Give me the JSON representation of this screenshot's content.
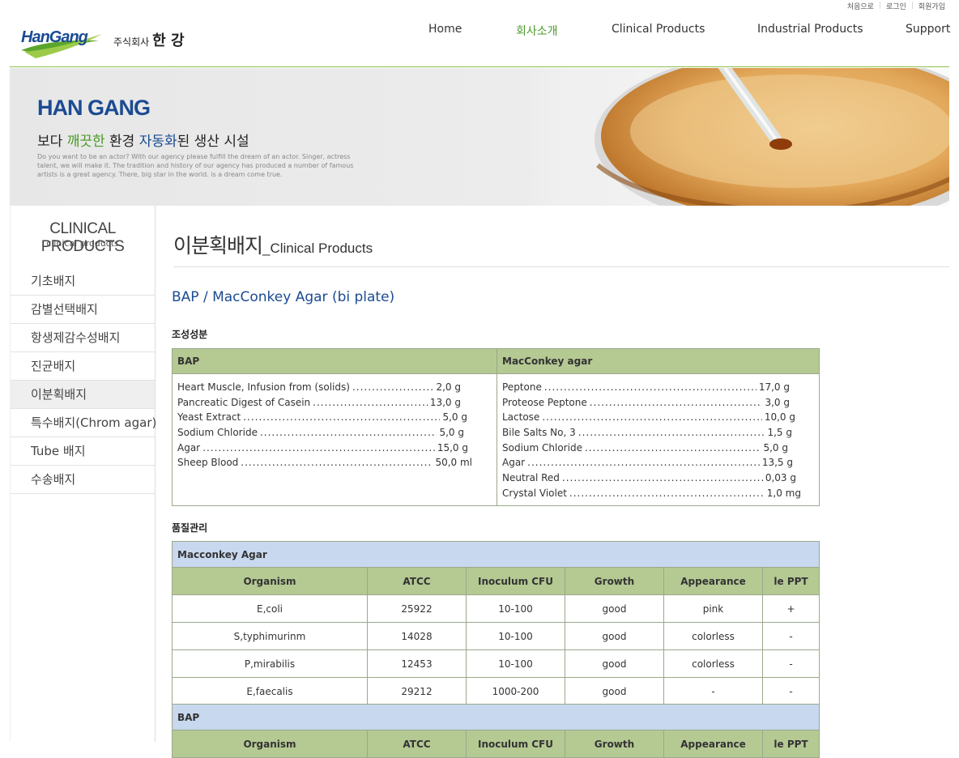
{
  "util": {
    "home": "처음으로",
    "login": "로그인",
    "join": "회원가입"
  },
  "logo": {
    "text": "HanGang",
    "company_prefix": "주식회사",
    "company_name": "한 강"
  },
  "nav": [
    "Home",
    "회사소개",
    "Clinical Products",
    "Industrial Products",
    "Support"
  ],
  "banner": {
    "title": "HAN GANG",
    "slogan_1": "보다 ",
    "slogan_green": "깨끗한",
    "slogan_2": " 환경 ",
    "slogan_blue": "자동화",
    "slogan_3": "된 생산 시설",
    "desc": "Do you want to be an actor? With our agency please fulfill the dream of an actor. Singer, actress talent, we will make it. The tradition and history of our agency has produced a number of famous artists is a great agency. There, big star in the world. is a dream come true."
  },
  "sidebar": {
    "title": "CLINICAL PRODUCTS",
    "subtitle": "clinical products",
    "items": [
      "기초배지",
      "감별선택배지",
      "항생제감수성배지",
      "진균배지",
      "이분획배지",
      "특수배지(Chrom agar)",
      "Tube 배지",
      "수송배지"
    ]
  },
  "page_title": {
    "kr": "이분획배지",
    "en": "_Clinical Products"
  },
  "product_name": "BAP / MacConkey Agar (bi plate)",
  "composition": {
    "label": "조성성분",
    "col1_header": "BAP",
    "col2_header": "MacConkey agar",
    "bap": [
      {
        "name": "Heart Muscle, Infusion from (solids)",
        "value": "2,0 g"
      },
      {
        "name": "Pancreatic Digest of Casein",
        "value": "13,0 g"
      },
      {
        "name": "Yeast Extract",
        "value": "5,0 g"
      },
      {
        "name": "Sodium Chloride",
        "value": "5,0 g"
      },
      {
        "name": "Agar",
        "value": "15,0 g"
      },
      {
        "name": "Sheep Blood",
        "value": "50,0 ml"
      }
    ],
    "macconkey": [
      {
        "name": "Peptone",
        "value": "17,0 g"
      },
      {
        "name": "Proteose Peptone",
        "value": "3,0 g"
      },
      {
        "name": "Lactose",
        "value": "10,0 g"
      },
      {
        "name": "Bile Salts No, 3",
        "value": "1,5 g"
      },
      {
        "name": "Sodium Chloride",
        "value": "5,0 g"
      },
      {
        "name": "Agar",
        "value": "13,5 g"
      },
      {
        "name": "Neutral Red",
        "value": "0,03 g"
      },
      {
        "name": "Crystal Violet",
        "value": "1,0 mg"
      }
    ]
  },
  "qc": {
    "label": "품질관리",
    "macconkey": {
      "caption": "Macconkey Agar",
      "headers": [
        "Organism",
        "ATCC",
        "Inoculum CFU",
        "Growth",
        "Appearance",
        "le PPT"
      ],
      "rows": [
        [
          "E,coli",
          "25922",
          "10-100",
          "good",
          "pink",
          "+"
        ],
        [
          "S,typhimurinm",
          "14028",
          "10-100",
          "good",
          "colorless",
          "-"
        ],
        [
          "P,mirabilis",
          "12453",
          "10-100",
          "good",
          "colorless",
          "-"
        ],
        [
          "E,faecalis",
          "29212",
          "1000-200",
          "good",
          "-",
          "-"
        ]
      ]
    },
    "bap": {
      "caption": "BAP",
      "headers": [
        "Organism",
        "ATCC",
        "Inoculum CFU",
        "Growth",
        "Appearance",
        "le PPT"
      ]
    }
  },
  "colors": {
    "brand_green": "#4b9a2a",
    "brand_blue": "#1b4b92",
    "table_header_green": "#b5c993",
    "table_caption_blue": "#c8d8ef"
  }
}
